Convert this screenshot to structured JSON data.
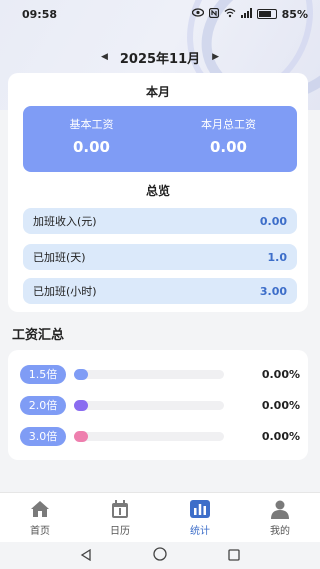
{
  "status": {
    "time": "09:58",
    "battery_text": "85%"
  },
  "month_nav": {
    "prev_icon": "chevron-left-icon",
    "label": "2025年11月",
    "next_icon": "chevron-right-icon"
  },
  "this_month": {
    "title": "本月",
    "base_salary_label": "基本工资",
    "base_salary_value": "0.00",
    "total_salary_label": "本月总工资",
    "total_salary_value": "0.00"
  },
  "overview": {
    "title": "总览",
    "rows": [
      {
        "label": "加班收入(元)",
        "value": "0.00"
      },
      {
        "label": "已加班(天)",
        "value": "1.0"
      },
      {
        "label": "已加班(小时)",
        "value": "3.00"
      }
    ]
  },
  "summary": {
    "title": "工资汇总",
    "rows": [
      {
        "multiplier": "1.5倍",
        "percent": "0.00%",
        "color": "#7f9cf5",
        "fraction": 0
      },
      {
        "multiplier": "2.0倍",
        "percent": "0.00%",
        "color": "#8a6cf0",
        "fraction": 0
      },
      {
        "multiplier": "3.0倍",
        "percent": "0.00%",
        "color": "#ee7fae",
        "fraction": 0
      }
    ]
  },
  "tabs": [
    {
      "label": "首页",
      "icon": "home-icon"
    },
    {
      "label": "日历",
      "icon": "calendar-icon"
    },
    {
      "label": "统计",
      "icon": "chart-icon",
      "active": true
    },
    {
      "label": "我的",
      "icon": "person-icon"
    }
  ],
  "colors": {
    "accent": "#7f9cf5",
    "active_tab": "#3d6ec9",
    "row_bg": "#dbe9fa"
  }
}
